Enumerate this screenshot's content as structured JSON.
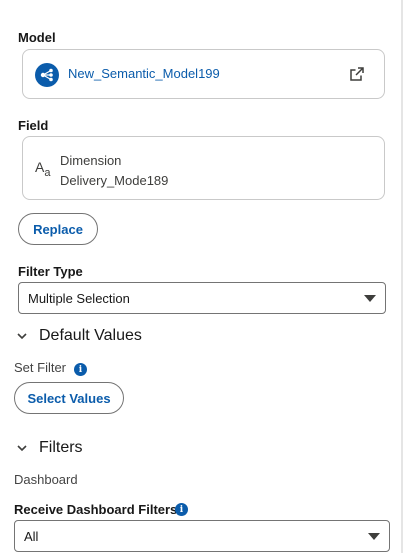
{
  "model": {
    "label": "Model",
    "name": "New_Semantic_Model199"
  },
  "field": {
    "label": "Field",
    "type": "Dimension",
    "name": "Delivery_Mode189",
    "icon_big": "A",
    "icon_small": "a"
  },
  "replace_button": "Replace",
  "filter_type": {
    "label": "Filter Type",
    "selected": "Multiple Selection"
  },
  "default_values": {
    "header": "Default Values",
    "set_filter_label": "Set Filter",
    "select_values_button": "Select Values"
  },
  "filters": {
    "header": "Filters",
    "dashboard_label": "Dashboard",
    "receive_label": "Receive Dashboard Filters",
    "receive_selected": "All"
  },
  "info_glyph": "i",
  "colors": {
    "brand_blue": "#0b5cab",
    "border": "#c9c9c9",
    "text": "#181818"
  },
  "icons": {
    "model": "semantic-model-icon",
    "open": "open-in-new-window-icon",
    "field": "text-dimension-icon",
    "chevron": "chevron-down-icon",
    "info": "info-icon",
    "caret": "caret-down-icon"
  }
}
